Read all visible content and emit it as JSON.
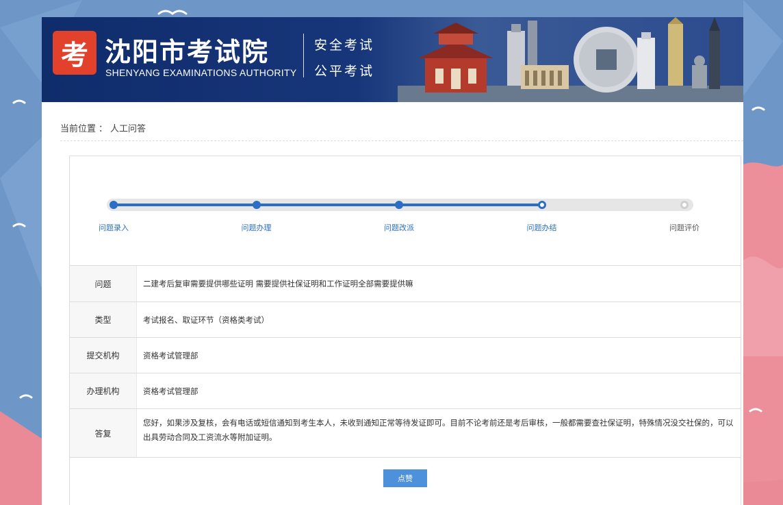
{
  "site": {
    "logo_char": "考",
    "name_cn": "沈阳市考试院",
    "name_en": "SHENYANG EXAMINATIONS AUTHORITY",
    "slogan_line1": "安全考试",
    "slogan_line2": "公平考试"
  },
  "breadcrumb": {
    "prefix": "当前位置",
    "separator": "：",
    "current": "人工问答"
  },
  "progress": {
    "steps": [
      {
        "label": "问题录入",
        "state": "done"
      },
      {
        "label": "问题办理",
        "state": "done"
      },
      {
        "label": "问题改派",
        "state": "done"
      },
      {
        "label": "问题办结",
        "state": "current"
      },
      {
        "label": "问题评价",
        "state": "todo"
      }
    ],
    "completed_fraction": 0.75
  },
  "details": [
    {
      "label": "问题",
      "value": "二建考后复审需要提供哪些证明 需要提供社保证明和工作证明全部需要提供嘛"
    },
    {
      "label": "类型",
      "value": "考试报名、取证环节（资格类考试）"
    },
    {
      "label": "提交机构",
      "value": "资格考试管理部"
    },
    {
      "label": "办理机构",
      "value": "资格考试管理部"
    },
    {
      "label": "答复",
      "value": "您好，如果涉及复核，会有电话或短信通知到考生本人，未收到通知正常等待发证即可。目前不论考前还是考后审核，一般都需要查社保证明，特殊情况没交社保的，可以出具劳动合同及工资流水等附加证明。"
    }
  ],
  "actions": {
    "like_label": "点赞"
  },
  "colors": {
    "brand_blue": "#17367a",
    "accent_blue": "#2a6ec6",
    "button_blue": "#4d90dc",
    "logo_red": "#e2422b"
  }
}
